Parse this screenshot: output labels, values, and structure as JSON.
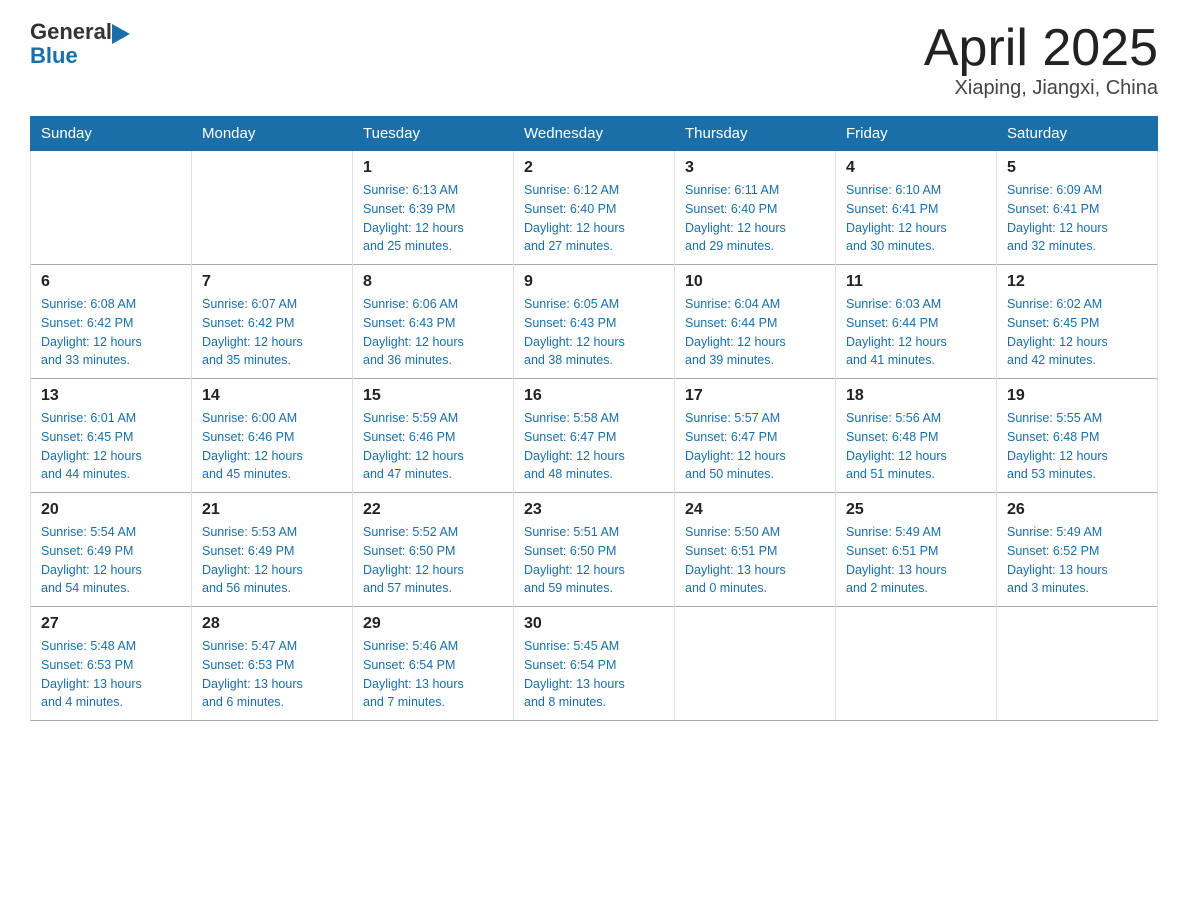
{
  "header": {
    "logo_general": "General",
    "logo_blue": "Blue",
    "title": "April 2025",
    "subtitle": "Xiaping, Jiangxi, China"
  },
  "weekdays": [
    "Sunday",
    "Monday",
    "Tuesday",
    "Wednesday",
    "Thursday",
    "Friday",
    "Saturday"
  ],
  "weeks": [
    [
      {
        "day": "",
        "info": ""
      },
      {
        "day": "",
        "info": ""
      },
      {
        "day": "1",
        "info": "Sunrise: 6:13 AM\nSunset: 6:39 PM\nDaylight: 12 hours\nand 25 minutes."
      },
      {
        "day": "2",
        "info": "Sunrise: 6:12 AM\nSunset: 6:40 PM\nDaylight: 12 hours\nand 27 minutes."
      },
      {
        "day": "3",
        "info": "Sunrise: 6:11 AM\nSunset: 6:40 PM\nDaylight: 12 hours\nand 29 minutes."
      },
      {
        "day": "4",
        "info": "Sunrise: 6:10 AM\nSunset: 6:41 PM\nDaylight: 12 hours\nand 30 minutes."
      },
      {
        "day": "5",
        "info": "Sunrise: 6:09 AM\nSunset: 6:41 PM\nDaylight: 12 hours\nand 32 minutes."
      }
    ],
    [
      {
        "day": "6",
        "info": "Sunrise: 6:08 AM\nSunset: 6:42 PM\nDaylight: 12 hours\nand 33 minutes."
      },
      {
        "day": "7",
        "info": "Sunrise: 6:07 AM\nSunset: 6:42 PM\nDaylight: 12 hours\nand 35 minutes."
      },
      {
        "day": "8",
        "info": "Sunrise: 6:06 AM\nSunset: 6:43 PM\nDaylight: 12 hours\nand 36 minutes."
      },
      {
        "day": "9",
        "info": "Sunrise: 6:05 AM\nSunset: 6:43 PM\nDaylight: 12 hours\nand 38 minutes."
      },
      {
        "day": "10",
        "info": "Sunrise: 6:04 AM\nSunset: 6:44 PM\nDaylight: 12 hours\nand 39 minutes."
      },
      {
        "day": "11",
        "info": "Sunrise: 6:03 AM\nSunset: 6:44 PM\nDaylight: 12 hours\nand 41 minutes."
      },
      {
        "day": "12",
        "info": "Sunrise: 6:02 AM\nSunset: 6:45 PM\nDaylight: 12 hours\nand 42 minutes."
      }
    ],
    [
      {
        "day": "13",
        "info": "Sunrise: 6:01 AM\nSunset: 6:45 PM\nDaylight: 12 hours\nand 44 minutes."
      },
      {
        "day": "14",
        "info": "Sunrise: 6:00 AM\nSunset: 6:46 PM\nDaylight: 12 hours\nand 45 minutes."
      },
      {
        "day": "15",
        "info": "Sunrise: 5:59 AM\nSunset: 6:46 PM\nDaylight: 12 hours\nand 47 minutes."
      },
      {
        "day": "16",
        "info": "Sunrise: 5:58 AM\nSunset: 6:47 PM\nDaylight: 12 hours\nand 48 minutes."
      },
      {
        "day": "17",
        "info": "Sunrise: 5:57 AM\nSunset: 6:47 PM\nDaylight: 12 hours\nand 50 minutes."
      },
      {
        "day": "18",
        "info": "Sunrise: 5:56 AM\nSunset: 6:48 PM\nDaylight: 12 hours\nand 51 minutes."
      },
      {
        "day": "19",
        "info": "Sunrise: 5:55 AM\nSunset: 6:48 PM\nDaylight: 12 hours\nand 53 minutes."
      }
    ],
    [
      {
        "day": "20",
        "info": "Sunrise: 5:54 AM\nSunset: 6:49 PM\nDaylight: 12 hours\nand 54 minutes."
      },
      {
        "day": "21",
        "info": "Sunrise: 5:53 AM\nSunset: 6:49 PM\nDaylight: 12 hours\nand 56 minutes."
      },
      {
        "day": "22",
        "info": "Sunrise: 5:52 AM\nSunset: 6:50 PM\nDaylight: 12 hours\nand 57 minutes."
      },
      {
        "day": "23",
        "info": "Sunrise: 5:51 AM\nSunset: 6:50 PM\nDaylight: 12 hours\nand 59 minutes."
      },
      {
        "day": "24",
        "info": "Sunrise: 5:50 AM\nSunset: 6:51 PM\nDaylight: 13 hours\nand 0 minutes."
      },
      {
        "day": "25",
        "info": "Sunrise: 5:49 AM\nSunset: 6:51 PM\nDaylight: 13 hours\nand 2 minutes."
      },
      {
        "day": "26",
        "info": "Sunrise: 5:49 AM\nSunset: 6:52 PM\nDaylight: 13 hours\nand 3 minutes."
      }
    ],
    [
      {
        "day": "27",
        "info": "Sunrise: 5:48 AM\nSunset: 6:53 PM\nDaylight: 13 hours\nand 4 minutes."
      },
      {
        "day": "28",
        "info": "Sunrise: 5:47 AM\nSunset: 6:53 PM\nDaylight: 13 hours\nand 6 minutes."
      },
      {
        "day": "29",
        "info": "Sunrise: 5:46 AM\nSunset: 6:54 PM\nDaylight: 13 hours\nand 7 minutes."
      },
      {
        "day": "30",
        "info": "Sunrise: 5:45 AM\nSunset: 6:54 PM\nDaylight: 13 hours\nand 8 minutes."
      },
      {
        "day": "",
        "info": ""
      },
      {
        "day": "",
        "info": ""
      },
      {
        "day": "",
        "info": ""
      }
    ]
  ]
}
